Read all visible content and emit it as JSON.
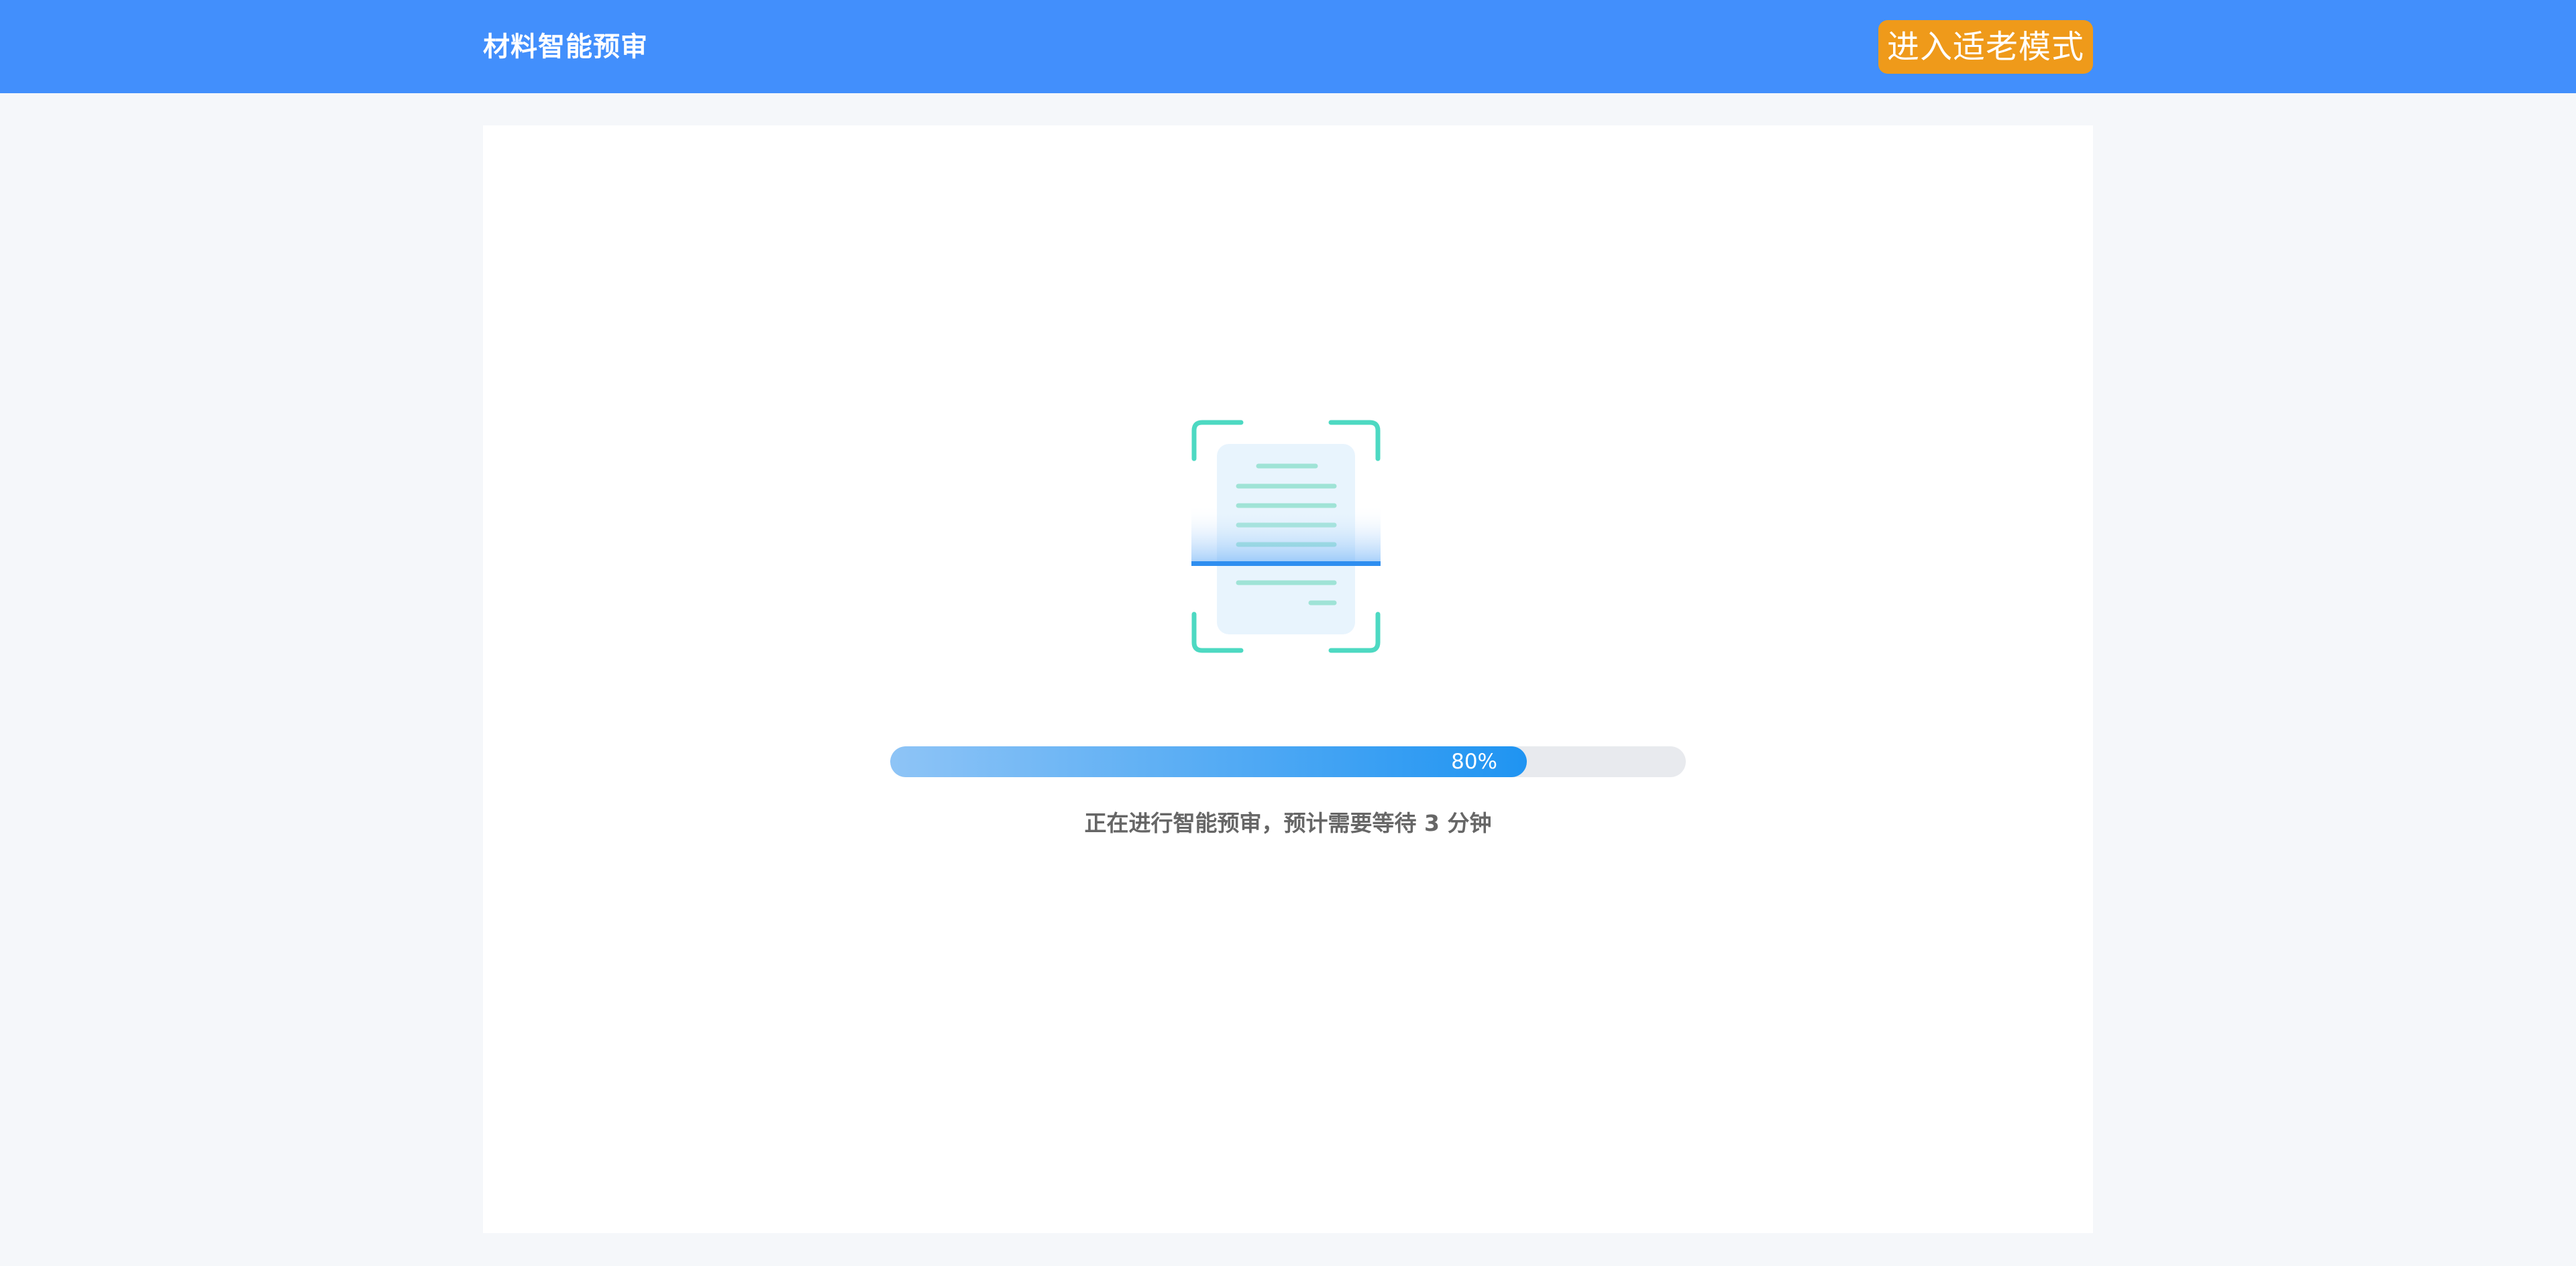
{
  "header": {
    "title": "材料智能预审",
    "elder_mode_label": "进入适老模式"
  },
  "main": {
    "illustration_icon": "document-scan-icon",
    "progress": {
      "value": 0.8,
      "label": "80%"
    },
    "status_text": "正在进行智能预审，预计需要等待 3 分钟"
  },
  "colors": {
    "header_bg": "#428ffc",
    "elder_button_bg": "#ef9a1a",
    "progress_start": "#8ec4f6",
    "progress_end": "#1f94f2",
    "scan_bracket": "#4dd9c2",
    "scan_line": "#2e8ef0"
  }
}
